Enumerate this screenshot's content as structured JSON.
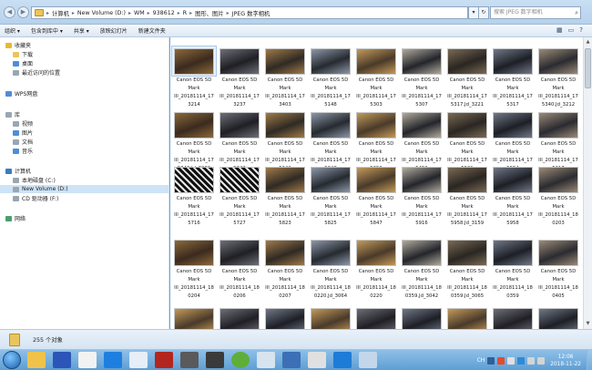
{
  "address": {
    "crumbs": [
      "计算机",
      "New Volume (D:)",
      "WM",
      "938612",
      "R",
      "图形、图片",
      "JPEG 数字相机"
    ]
  },
  "search": {
    "placeholder": "搜索 JPEG 数字相机"
  },
  "toolbar": {
    "items": [
      "组织 ▾",
      "包含到库中 ▾",
      "共享 ▾",
      "放映幻灯片",
      "新建文件夹"
    ]
  },
  "nav": {
    "items": [
      {
        "label": "收藏夹",
        "icon": "star-icon",
        "indent": 0
      },
      {
        "label": "下载",
        "icon": "folder-icon",
        "indent": 1
      },
      {
        "label": "桌面",
        "icon": "desktop-icon",
        "indent": 1
      },
      {
        "label": "最近访问的位置",
        "icon": "recent-icon",
        "indent": 1
      },
      {
        "label": "WPS网盘",
        "icon": "cloud-icon",
        "indent": 0
      },
      {
        "label": "库",
        "icon": "library-icon",
        "indent": 0
      },
      {
        "label": "视频",
        "icon": "video-icon",
        "indent": 1
      },
      {
        "label": "图片",
        "icon": "picture-icon",
        "indent": 1
      },
      {
        "label": "文档",
        "icon": "document-icon",
        "indent": 1
      },
      {
        "label": "音乐",
        "icon": "music-icon",
        "indent": 1
      },
      {
        "label": "计算机",
        "icon": "computer-icon",
        "indent": 0
      },
      {
        "label": "本地磁盘 (C:)",
        "icon": "drive-icon",
        "indent": 1
      },
      {
        "label": "New Volume (D:)",
        "icon": "drive-icon",
        "indent": 1,
        "selected": true
      },
      {
        "label": "CD 驱动器 (F:)",
        "icon": "cd-drive-icon",
        "indent": 1
      },
      {
        "label": "网络",
        "icon": "network-icon",
        "indent": 0
      }
    ]
  },
  "files": [
    [
      "Canon EOS 5D",
      "Mark",
      "III_20181114_17",
      "3214"
    ],
    [
      "Canon EOS 5D",
      "Mark",
      "III_20181114_17",
      "3237"
    ],
    [
      "Canon EOS 5D",
      "Mark",
      "III_20181114_17",
      "3403"
    ],
    [
      "Canon EOS 5D",
      "Mark",
      "III_20181114_17",
      "5148"
    ],
    [
      "Canon EOS 5D",
      "Mark",
      "III_20181114_17",
      "5303"
    ],
    [
      "Canon EOS 5D",
      "Mark",
      "III_20181114_17",
      "5307"
    ],
    [
      "Canon EOS 5D",
      "Mark",
      "III_20181114_17",
      "5317.Jd_3221"
    ],
    [
      "Canon EOS 5D",
      "Mark",
      "III_20181114_17",
      "5317"
    ],
    [
      "Canon EOS 5D",
      "Mark",
      "III_20181114_17",
      "5340.Jd_3212"
    ],
    [
      "Canon EOS 5D",
      "Mark",
      "III_20181114_17",
      "5342.Jd_3060"
    ],
    [
      "Canon EOS 5D",
      "Mark",
      "III_20181114_17",
      "5342"
    ],
    [
      "Canon EOS 5D",
      "Mark",
      "III_20181114_17",
      "5342"
    ],
    [
      "Canon EOS 5D",
      "Mark",
      "III_20181114_17",
      "5348"
    ],
    [
      "Canon EOS 5D",
      "Mark",
      "III_20181114_17",
      "5350"
    ],
    [
      "Canon EOS 5D",
      "Mark",
      "III_20181114_17",
      "5452"
    ],
    [
      "Canon EOS 5D",
      "Mark",
      "III_20181114_17",
      "5531"
    ],
    [
      "Canon EOS 5D",
      "Mark",
      "III_20181114_17",
      "5554"
    ],
    [
      "Canon EOS 5D",
      "Mark",
      "III_20181114_17",
      "5617"
    ],
    [
      "Canon EOS 5D",
      "Mark",
      "III_20181114_17",
      "5716"
    ],
    [
      "Canon EOS 5D",
      "Mark",
      "III_20181114_17",
      "5727"
    ],
    [
      "Canon EOS 5D",
      "Mark",
      "III_20181114_17",
      "5823"
    ],
    [
      "Canon EOS 5D",
      "Mark",
      "III_20181114_17",
      "5825"
    ],
    [
      "Canon EOS 5D",
      "Mark",
      "III_20181114_17",
      "5847"
    ],
    [
      "Canon EOS 5D",
      "Mark",
      "III_20181114_17",
      "5916"
    ],
    [
      "Canon EOS 5D",
      "Mark",
      "III_20181114_17",
      "5958.Jd_3159"
    ],
    [
      "Canon EOS 5D",
      "Mark",
      "III_20181114_17",
      "5958"
    ],
    [
      "Canon EOS 5D",
      "Mark",
      "III_20181114_18",
      "0203"
    ],
    [
      "Canon EOS 5D",
      "Mark",
      "III_20181114_18",
      "0204"
    ],
    [
      "Canon EOS 5D",
      "Mark",
      "III_20181114_18",
      "0206"
    ],
    [
      "Canon EOS 5D",
      "Mark",
      "III_20181114_18",
      "0207"
    ],
    [
      "Canon EOS 5D",
      "Mark",
      "III_20181114_18",
      "0220.Jd_3064"
    ],
    [
      "Canon EOS 5D",
      "Mark",
      "III_20181114_18",
      "0220"
    ],
    [
      "Canon EOS 5D",
      "Mark",
      "III_20181114_18",
      "0359.Jd_3042"
    ],
    [
      "Canon EOS 5D",
      "Mark",
      "III_20181114_18",
      "0359.Jd_3065"
    ],
    [
      "Canon EOS 5D",
      "Mark",
      "III_20181114_18",
      "0359"
    ],
    [
      "Canon EOS 5D",
      "Mark",
      "III_20181114_18",
      "0405"
    ]
  ],
  "status": {
    "count": "255 个对象"
  },
  "clock": {
    "time": "12:06",
    "date": "2018-11-22"
  },
  "tray": {
    "lang": "CH"
  }
}
